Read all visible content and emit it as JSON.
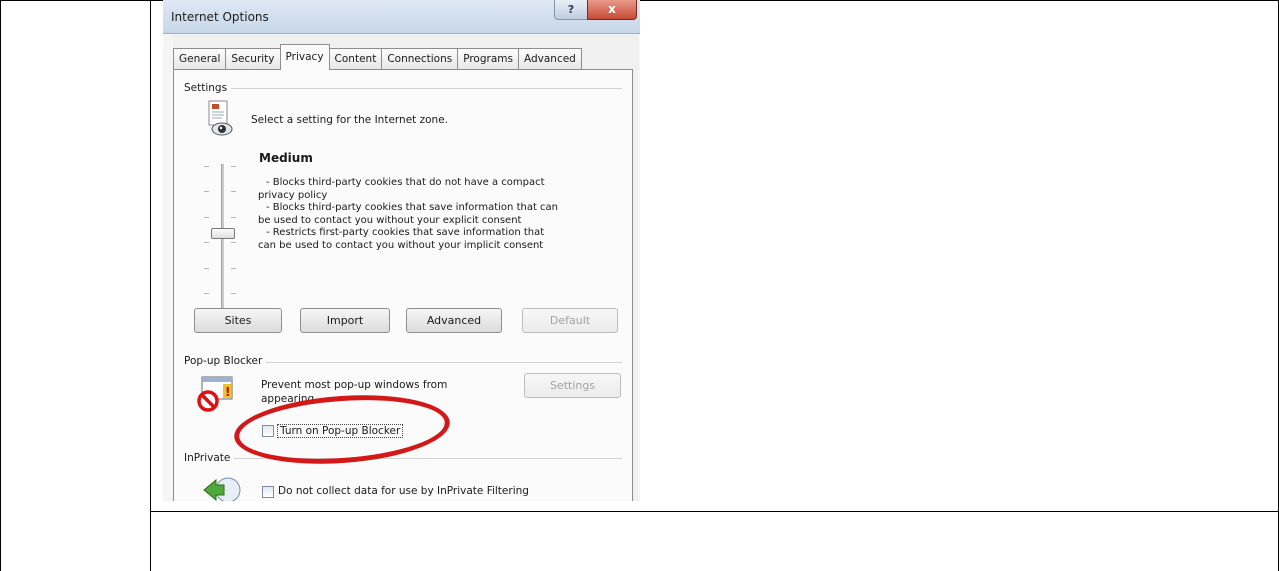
{
  "window": {
    "title": "Internet Options",
    "help_label": "?",
    "close_label": "x"
  },
  "tabs": [
    "General",
    "Security",
    "Privacy",
    "Content",
    "Connections",
    "Programs",
    "Advanced"
  ],
  "active_tab": "Privacy",
  "settings": {
    "group_label": "Settings",
    "prompt": "Select a setting for the Internet zone.",
    "level": "Medium",
    "description_lines": [
      "- Blocks third-party cookies that do not have a compact",
      "privacy policy",
      "- Blocks third-party cookies that save information that can",
      "be used to contact you without your explicit consent",
      "- Restricts first-party cookies that save information that",
      "can be used to contact you without your implicit consent"
    ],
    "buttons": {
      "sites": "Sites",
      "import": "Import",
      "advanced": "Advanced",
      "default": "Default"
    }
  },
  "popup_blocker": {
    "group_label": "Pop-up Blocker",
    "description_line1": "Prevent most pop-up windows from",
    "description_line2": "appearing.",
    "settings_button": "Settings",
    "checkbox_label": "Turn on Pop-up Blocker",
    "checked": false
  },
  "inprivate": {
    "group_label": "InPrivate",
    "checkbox_label": "Do not collect data for use by InPrivate Filtering",
    "checked": false
  },
  "annotation": {
    "color": "#d41818",
    "shape": "ellipse"
  }
}
